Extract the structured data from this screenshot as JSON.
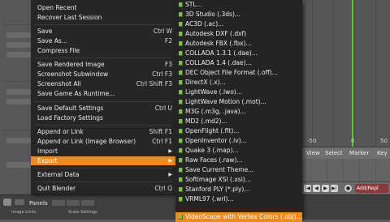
{
  "file_menu": {
    "items": [
      {
        "label": "Open Recent",
        "shortcut": ""
      },
      {
        "label": "Recover Last Session",
        "shortcut": ""
      },
      {
        "label": "Save",
        "shortcut": "Ctrl W"
      },
      {
        "label": "Save As...",
        "shortcut": "F2"
      },
      {
        "label": "Compress File",
        "shortcut": ""
      },
      {
        "label": "Save Rendered Image",
        "shortcut": "F3"
      },
      {
        "label": "Screenshot Subwindow",
        "shortcut": "Ctrl F3"
      },
      {
        "label": "Screenshot All",
        "shortcut": "Ctrl Shift F3"
      },
      {
        "label": "Save Game As Runtime...",
        "shortcut": ""
      },
      {
        "label": "Save Default Settings",
        "shortcut": "Ctrl U"
      },
      {
        "label": "Load Factory Settings",
        "shortcut": ""
      },
      {
        "label": "Append or Link",
        "shortcut": "Shift F1"
      },
      {
        "label": "Append or Link (Image Browser)",
        "shortcut": "Ctrl F1"
      },
      {
        "label": "Import",
        "shortcut": ""
      },
      {
        "label": "Export",
        "shortcut": ""
      },
      {
        "label": "External Data",
        "shortcut": ""
      },
      {
        "label": "Quit Blender",
        "shortcut": "Ctrl Q"
      }
    ]
  },
  "export_menu": {
    "items": [
      "STL...",
      "3D Studio (.3ds)...",
      "AC3D (.ac)...",
      "Autodesk DXF (.dxf)",
      "Autodesk FBX (.fbx)...",
      "COLLADA 1.3.1 (.dae)...",
      "COLLADA 1.4 (.dae)...",
      "DEC Object File Format (.off)...",
      "DirectX (.x)...",
      "LightWave (.lwo)...",
      "LightWave Motion (.mot)...",
      "M3G (.m3g, .java)...",
      "MD2 (.md2)...",
      "OpenFlight (.flt)...",
      "OpenInventor (.iv)...",
      "Quake 3 (.map)...",
      "Raw Faces (.raw)...",
      "Save Current Theme...",
      "Softimage XSI (.xsi)...",
      "Stanford PLY (*.ply)...",
      "VRML97 (.wrl)...",
      "VideoScape with Vertex Colors (.obj)..."
    ]
  },
  "timeline": {
    "ticks": [
      "-50",
      "0",
      "50"
    ],
    "menu": [
      "View",
      "Select",
      "Marker",
      "Key"
    ],
    "autokey_label": "Add/Repl"
  },
  "bottom_bar": {
    "panels_label": "Panels",
    "mini_1": "Image Links",
    "mini_2": "Scale Settings"
  },
  "colors": {
    "menu_bg": "#262626",
    "highlight": "#f08a1c",
    "timeline_green": "#5fbf3f"
  }
}
